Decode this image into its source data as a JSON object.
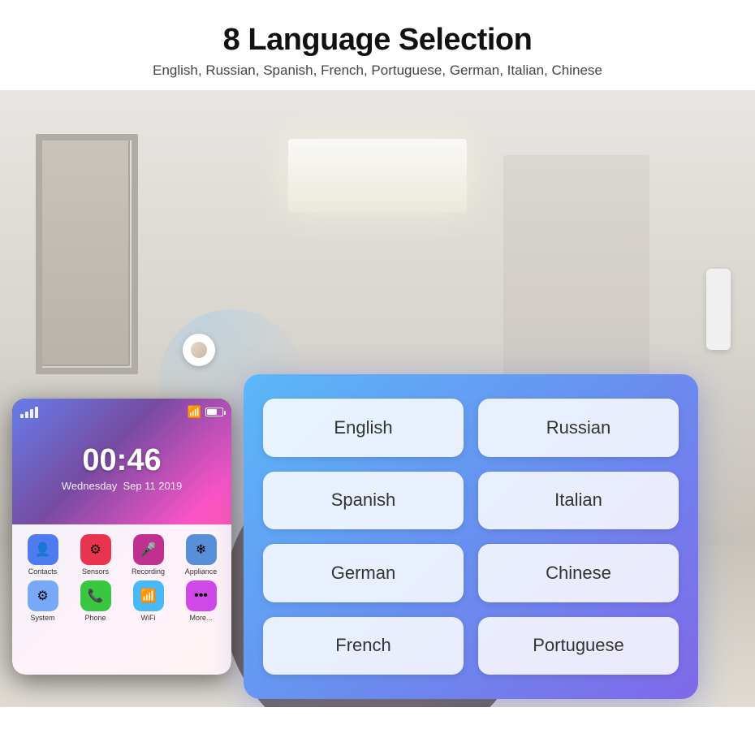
{
  "header": {
    "title": "8 Language Selection",
    "subtitle": "English, Russian, Spanish, French, Portuguese, German, Italian, Chinese"
  },
  "phone": {
    "time": "00:46",
    "day": "Wednesday",
    "date": "Sep 11 2019",
    "apps": [
      {
        "label": "Contacts",
        "icon": "👤",
        "class": "app-contacts"
      },
      {
        "label": "Sensors",
        "icon": "⚙",
        "class": "app-sensors"
      },
      {
        "label": "Recording",
        "icon": "🎤",
        "class": "app-recording"
      },
      {
        "label": "Appliance",
        "icon": "❄",
        "class": "app-appliance"
      },
      {
        "label": "System",
        "icon": "⚙",
        "class": "app-system"
      },
      {
        "label": "Phone",
        "icon": "📞",
        "class": "app-phone"
      },
      {
        "label": "WiFi",
        "icon": "📶",
        "class": "app-wifi"
      },
      {
        "label": "More...",
        "icon": "•••",
        "class": "app-more"
      }
    ]
  },
  "languages": {
    "panel_bg": "linear-gradient(135deg, #5bb8f8, #8068e8)",
    "buttons": [
      {
        "id": "english",
        "label": "English"
      },
      {
        "id": "russian",
        "label": "Russian"
      },
      {
        "id": "spanish",
        "label": "Spanish"
      },
      {
        "id": "italian",
        "label": "Italian"
      },
      {
        "id": "german",
        "label": "German"
      },
      {
        "id": "chinese",
        "label": "Chinese"
      },
      {
        "id": "french",
        "label": "French"
      },
      {
        "id": "portuguese",
        "label": "Portuguese"
      }
    ]
  }
}
